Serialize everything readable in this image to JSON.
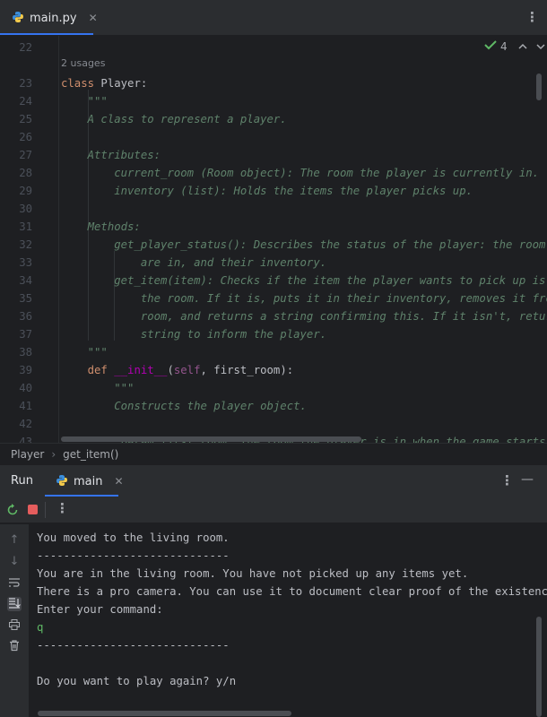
{
  "editor_tab": {
    "label": "main.py",
    "close": "✕"
  },
  "inspections": {
    "count": "4"
  },
  "editor": {
    "usages": "2 usages",
    "lines": [
      {
        "n": "22",
        "parts": []
      },
      {
        "n": "23",
        "parts": [
          {
            "c": "kw",
            "t": "class "
          },
          {
            "c": "plain",
            "t": "Player:"
          }
        ]
      },
      {
        "n": "24",
        "parts": [
          {
            "c": "doc",
            "t": "    \"\"\""
          }
        ]
      },
      {
        "n": "25",
        "parts": [
          {
            "c": "doc",
            "t": "    A class to represent a player."
          }
        ]
      },
      {
        "n": "26",
        "parts": []
      },
      {
        "n": "27",
        "parts": [
          {
            "c": "doc",
            "t": "    Attributes:"
          }
        ]
      },
      {
        "n": "28",
        "parts": [
          {
            "c": "doc",
            "t": "        current_room (Room object): The room the player is currently in."
          }
        ]
      },
      {
        "n": "29",
        "parts": [
          {
            "c": "doc",
            "t": "        inventory (list): Holds the items the player picks up."
          }
        ]
      },
      {
        "n": "30",
        "parts": []
      },
      {
        "n": "31",
        "parts": [
          {
            "c": "doc",
            "t": "    Methods:"
          }
        ]
      },
      {
        "n": "32",
        "parts": [
          {
            "c": "doc",
            "t": "        get_player_status(): Describes the status of the player: the room t"
          }
        ]
      },
      {
        "n": "33",
        "parts": [
          {
            "c": "doc",
            "t": "            are in, and their inventory."
          }
        ]
      },
      {
        "n": "34",
        "parts": [
          {
            "c": "doc",
            "t": "        get_item(item): Checks if the item the player wants to pick up is i"
          }
        ]
      },
      {
        "n": "35",
        "parts": [
          {
            "c": "doc",
            "t": "            the room. If it is, puts it in their inventory, removes it from"
          }
        ]
      },
      {
        "n": "36",
        "parts": [
          {
            "c": "doc",
            "t": "            room, and returns a string confirming this. If it isn't, return"
          }
        ]
      },
      {
        "n": "37",
        "parts": [
          {
            "c": "doc",
            "t": "            string to inform the player."
          }
        ]
      },
      {
        "n": "38",
        "parts": [
          {
            "c": "doc",
            "t": "    \"\"\""
          }
        ]
      },
      {
        "n": "39",
        "parts": [
          {
            "c": "kw",
            "t": "    def "
          },
          {
            "c": "fn",
            "t": "__init__"
          },
          {
            "c": "plain",
            "t": "("
          },
          {
            "c": "slf",
            "t": "self"
          },
          {
            "c": "plain",
            "t": ", first_room):"
          }
        ]
      },
      {
        "n": "40",
        "parts": [
          {
            "c": "doc",
            "t": "        \"\"\""
          }
        ]
      },
      {
        "n": "41",
        "parts": [
          {
            "c": "doc",
            "t": "        Constructs the player object."
          }
        ]
      },
      {
        "n": "42",
        "parts": []
      },
      {
        "n": "43",
        "parts": [
          {
            "c": "doc",
            "t": "        :param first_room: The room the player is in when the game starts."
          }
        ]
      }
    ]
  },
  "breadcrumb": {
    "items": [
      "Player",
      "get_item()"
    ],
    "sep": "›"
  },
  "run": {
    "title": "Run",
    "tab_label": "main",
    "tab_close": "✕"
  },
  "console": {
    "lines": [
      {
        "t": "You moved to the living room.",
        "input": false
      },
      {
        "t": "-----------------------------",
        "input": false
      },
      {
        "t": "You are in the living room. You have not picked up any items yet.",
        "input": false
      },
      {
        "t": "There is a pro camera. You can use it to document clear proof of the existence",
        "input": false
      },
      {
        "t": "Enter your command:",
        "input": false
      },
      {
        "t": "q",
        "input": true
      },
      {
        "t": "-----------------------------",
        "input": false
      },
      {
        "t": "",
        "input": false
      },
      {
        "t": "Do you want to play again? y/n",
        "input": false
      }
    ]
  },
  "colors": {
    "accent": "#3574f0",
    "stop": "#e55d5d",
    "rerun": "#5fb865",
    "check": "#5fb865"
  }
}
